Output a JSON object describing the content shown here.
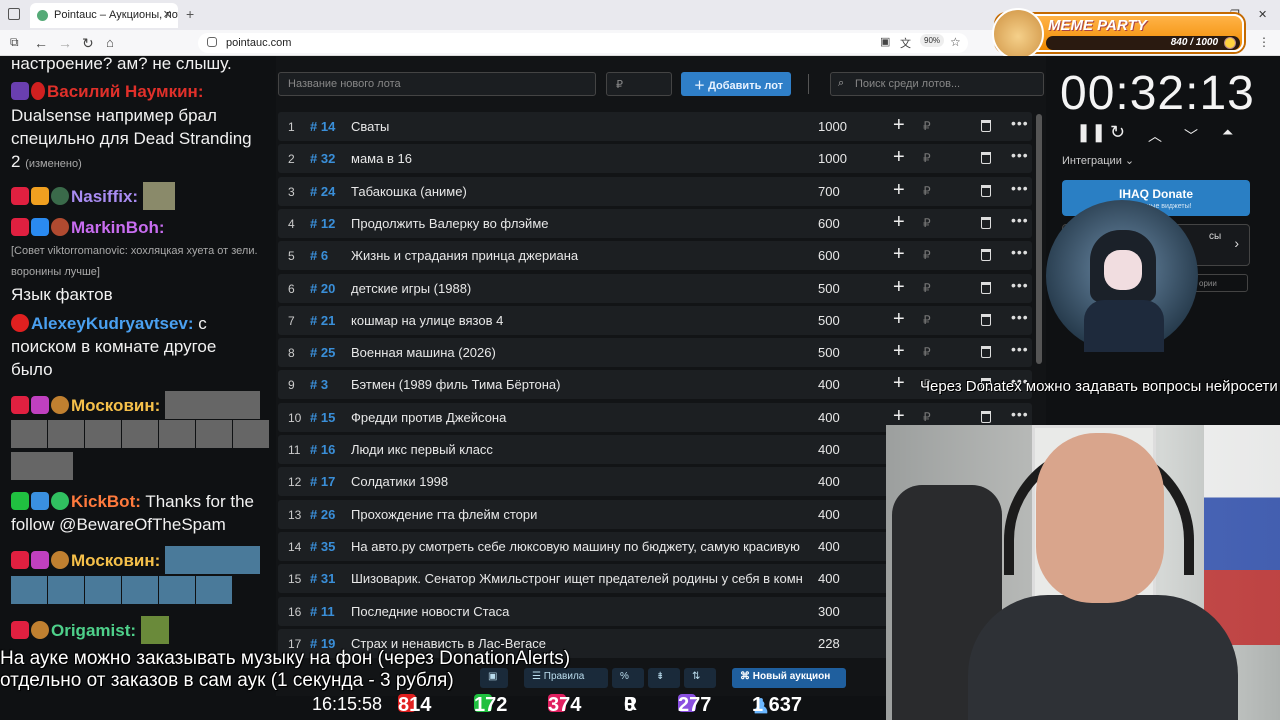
{
  "browser": {
    "tab_title": "Pointauc – Аукционы, лотерея",
    "url": "pointauc.com",
    "zoom": "90%"
  },
  "meme_party": {
    "title": "MEME PARTY",
    "score": "840 / 1000"
  },
  "chat": {
    "lines": [
      {
        "text": "настроение? ам? не слышу."
      },
      {
        "nick": "Василий Наумкин:",
        "color": "#e0302a"
      },
      {
        "text": "Dualsense например брал"
      },
      {
        "text": "специльно для Dead Stranding"
      },
      {
        "text": "2",
        "note": "(изменено)"
      },
      {
        "nick": "Nasiffix:",
        "color": "#a98cf2"
      },
      {
        "nick": "MarkinBoh:",
        "color": "#c86df0"
      },
      {
        "text_small": "[Совет viktorromanovic: хохляцкая хуета от зели."
      },
      {
        "text_small": "воронины лучше]"
      },
      {
        "text": "Язык фактов"
      },
      {
        "nick": "AlexeyKudryavtsev:",
        "color": "#4aa0f0",
        "text": " с"
      },
      {
        "text": "поиском в комнате другое"
      },
      {
        "text": "было"
      },
      {
        "nick": "Московин:",
        "color": "#f5c04a"
      },
      {
        "nick": "KickBot:",
        "color": "#ff7a3d",
        "text": " Thanks for the"
      },
      {
        "text": "follow @BewareOfTheSpam"
      },
      {
        "nick": "Московин:",
        "color": "#f5c04a"
      },
      {
        "nick": "Origamist:",
        "color": "#4ed08a"
      }
    ]
  },
  "auction": {
    "new_lot_placeholder": "Название нового лота",
    "amount_placeholder": "₽",
    "add_button": "Добавить лот",
    "search_placeholder": "Поиск среди лотов...",
    "currency": "₽",
    "lots": [
      {
        "n": "1",
        "id": "# 14",
        "name": "Сваты",
        "amount": "1000"
      },
      {
        "n": "2",
        "id": "# 32",
        "name": "мама в 16",
        "amount": "1000"
      },
      {
        "n": "3",
        "id": "# 24",
        "name": "Табакошка (аниме)",
        "amount": "700"
      },
      {
        "n": "4",
        "id": "# 12",
        "name": "Продолжить Валерку во флэйме",
        "amount": "600"
      },
      {
        "n": "5",
        "id": "# 6",
        "name": "Жизнь и страдания принца джериана",
        "amount": "600"
      },
      {
        "n": "6",
        "id": "# 20",
        "name": "детские игры (1988)",
        "amount": "500"
      },
      {
        "n": "7",
        "id": "# 21",
        "name": "кошмар на улице вязов 4",
        "amount": "500"
      },
      {
        "n": "8",
        "id": "# 25",
        "name": "Военная машина (2026)",
        "amount": "500"
      },
      {
        "n": "9",
        "id": "# 3",
        "name": "Бэтмен (1989 филь Тима Бёртона)",
        "amount": "400"
      },
      {
        "n": "10",
        "id": "# 15",
        "name": "Фредди против Джейсона",
        "amount": "400"
      },
      {
        "n": "11",
        "id": "# 16",
        "name": "Люди икс первый класс",
        "amount": "400"
      },
      {
        "n": "12",
        "id": "# 17",
        "name": "Солдатики 1998",
        "amount": "400"
      },
      {
        "n": "13",
        "id": "# 26",
        "name": "Прохождение гта флейм стори",
        "amount": "400"
      },
      {
        "n": "14",
        "id": "# 35",
        "name": "На авто.ру смотреть себе люксовую машину по бюджету, самую красивую",
        "amount": "400"
      },
      {
        "n": "15",
        "id": "# 31",
        "name": "Шизоварик. Сенатор Жмильстронг ищет предателей родины у себя в комнате",
        "amount": "400"
      },
      {
        "n": "16",
        "id": "# 11",
        "name": "Последние новости Стаса",
        "amount": "300"
      },
      {
        "n": "17",
        "id": "# 19",
        "name": "Страх и ненависть в Лас-Вегасе",
        "amount": "228"
      }
    ],
    "toolbar": {
      "rules": "Правила",
      "percent": "%",
      "new_auction": "Новый аукцион"
    }
  },
  "timer": {
    "value": "00:32:13",
    "integrations": "Интеграции"
  },
  "donate": {
    "label": "IHAQ Donate",
    "sub": "уникальные виджеты!",
    "box_text": "сы",
    "box_sub": "ории"
  },
  "overlays": {
    "donatex": "Через Donatex можно задавать вопросы нейросети",
    "music_line1": "На ауке можно заказывать музыку на фон (через DonationAlerts)",
    "music_line2": "отдельно от заказов в сам аук (1 секунда - 3 рубля)"
  },
  "stats": {
    "time": "16:15:58",
    "youtube": "814",
    "kick": "172",
    "vk": "374",
    "rutube": "0",
    "twitch": "277",
    "total": "1 637"
  },
  "colors": {
    "accent": "#2f7fc8",
    "lot_id": "#3a8fd9"
  }
}
